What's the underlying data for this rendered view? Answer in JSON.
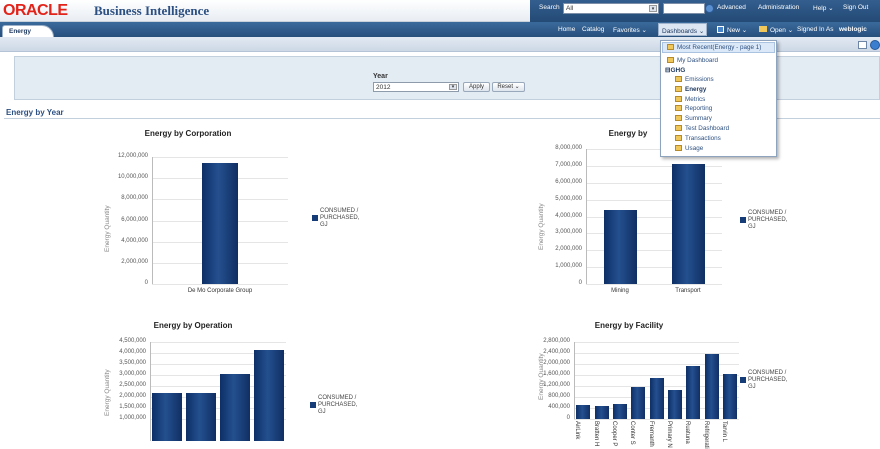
{
  "header": {
    "logo": "ORACLE",
    "product": "Business Intelligence",
    "search_label": "Search",
    "search_scope": "All",
    "advanced": "Advanced",
    "administration": "Administration",
    "help": "Help ⌄",
    "signout": "Sign Out"
  },
  "nav": {
    "home": "Home",
    "catalog": "Catalog",
    "favorites": "Favorites ⌄",
    "dashboards": "Dashboards ⌄",
    "new": "New ⌄",
    "open": "Open ⌄",
    "signed_in_as": "Signed In As",
    "user": "weblogic"
  },
  "page_tab": "Energy",
  "prompt": {
    "label": "Year",
    "value": "2012",
    "apply": "Apply",
    "reset": "Reset ⌄"
  },
  "section_title": "Energy by Year",
  "dropdown": {
    "most_recent": "Most Recent(Energy - page 1)",
    "my_dashboard": "My Dashboard",
    "group": "GHG",
    "items": [
      "Emissions",
      "Energy",
      "Metrics",
      "Reporting",
      "Summary",
      "Test Dashboard",
      "Transactions",
      "Usage"
    ]
  },
  "colors": {
    "bar": "#163c77",
    "accent": "#2d5082",
    "logo": "#e2231a"
  },
  "chart_data": [
    {
      "type": "bar",
      "title": "Energy by Corporation",
      "ylabel": "Energy Quantity",
      "legend": "CONSUMED /\nPURCHASED,\nGJ",
      "ylim": [
        0,
        12000000
      ],
      "yticks": [
        "12,000,000",
        "10,000,000",
        "8,000,000",
        "6,000,000",
        "4,000,000",
        "2,000,000",
        "0"
      ],
      "categories": [
        "De Mo Corporate Group"
      ],
      "values": [
        11400000
      ]
    },
    {
      "type": "bar",
      "title": "Energy by",
      "ylabel": "Energy Quantity",
      "legend": "CONSUMED /\nPURCHASED,\nGJ",
      "ylim": [
        0,
        8000000
      ],
      "yticks": [
        "8,000,000",
        "7,000,000",
        "6,000,000",
        "5,000,000",
        "4,000,000",
        "3,000,000",
        "2,000,000",
        "1,000,000",
        "0"
      ],
      "categories": [
        "Mining",
        "Transport"
      ],
      "values": [
        4400000,
        7100000
      ]
    },
    {
      "type": "bar",
      "title": "Energy by Operation",
      "ylabel": "Energy Quantity",
      "legend": "CONSUMED /\nPURCHASED,\nGJ",
      "ylim": [
        0,
        4500000
      ],
      "yticks": [
        "4,500,000",
        "4,000,000",
        "3,500,000",
        "3,000,000",
        "2,500,000",
        "2,000,000",
        "1,500,000",
        "1,000,000"
      ],
      "categories": [
        "",
        "",
        "",
        ""
      ],
      "values": [
        2200000,
        2170000,
        3050000,
        4150000
      ]
    },
    {
      "type": "bar",
      "title": "Energy by Facility",
      "ylabel": "Energy Quantity",
      "legend": "CONSUMED /\nPURCHASED,\nGJ",
      "ylim": [
        0,
        2800000
      ],
      "yticks": [
        "2,800,000",
        "2,400,000",
        "2,000,000",
        "1,600,000",
        "1,200,000",
        "800,000",
        "400,000",
        "0"
      ],
      "categories": [
        "AirLink",
        "Bratten H",
        "Cooper P",
        "Conter S",
        "Fremanth",
        "Primary N",
        "Ruatuna",
        "Refrigerati",
        "Tarvin L"
      ],
      "values": [
        500000,
        480000,
        560000,
        1180000,
        1490000,
        1050000,
        1940000,
        2380000,
        1620000
      ]
    }
  ]
}
